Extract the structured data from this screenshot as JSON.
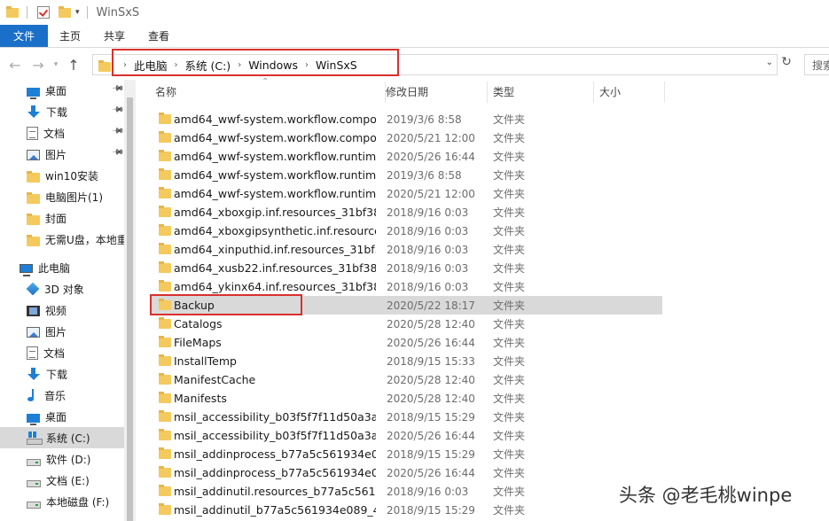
{
  "window": {
    "title": "WinSxS"
  },
  "ribbon": {
    "tabs": [
      "文件",
      "主页",
      "共享",
      "查看"
    ]
  },
  "address": {
    "crumbs": [
      "此电脑",
      "系统 (C:)",
      "Windows",
      "WinSxS"
    ],
    "search_placeholder": "搜索"
  },
  "sidebar": {
    "quick_access": [
      {
        "label": "桌面",
        "icon": "desktop-icon",
        "pinned": true
      },
      {
        "label": "下载",
        "icon": "download-icon",
        "pinned": true
      },
      {
        "label": "文档",
        "icon": "document-icon",
        "pinned": true
      },
      {
        "label": "图片",
        "icon": "picture-icon",
        "pinned": true
      },
      {
        "label": "win10安装",
        "icon": "folder-icon",
        "pinned": false
      },
      {
        "label": "电脑图片(1)",
        "icon": "folder-icon",
        "pinned": false
      },
      {
        "label": "封面",
        "icon": "folder-icon",
        "pinned": false
      },
      {
        "label": "无需U盘，本地重",
        "icon": "folder-icon",
        "pinned": false
      }
    ],
    "this_pc_label": "此电脑",
    "this_pc": [
      {
        "label": "3D 对象",
        "icon": "3d-objects-icon"
      },
      {
        "label": "视频",
        "icon": "video-icon"
      },
      {
        "label": "图片",
        "icon": "picture-icon"
      },
      {
        "label": "文档",
        "icon": "document-icon"
      },
      {
        "label": "下载",
        "icon": "download-icon"
      },
      {
        "label": "音乐",
        "icon": "music-icon"
      },
      {
        "label": "桌面",
        "icon": "desktop-icon"
      },
      {
        "label": "系统 (C:)",
        "icon": "windows-drive-icon",
        "selected": true
      },
      {
        "label": "软件 (D:)",
        "icon": "drive-icon"
      },
      {
        "label": "文档 (E:)",
        "icon": "drive-icon"
      },
      {
        "label": "本地磁盘 (F:)",
        "icon": "drive-icon"
      }
    ]
  },
  "columns": {
    "name": "名称",
    "date": "修改日期",
    "type": "类型",
    "size": "大小"
  },
  "files": [
    {
      "name": "amd64_wwf-system.workflow.compo...",
      "date": "2019/3/6 8:58",
      "type": "文件夹"
    },
    {
      "name": "amd64_wwf-system.workflow.compo...",
      "date": "2020/5/21 12:00",
      "type": "文件夹"
    },
    {
      "name": "amd64_wwf-system.workflow.runtime...",
      "date": "2020/5/26 16:44",
      "type": "文件夹"
    },
    {
      "name": "amd64_wwf-system.workflow.runtime...",
      "date": "2019/3/6 8:58",
      "type": "文件夹"
    },
    {
      "name": "amd64_wwf-system.workflow.runtime...",
      "date": "2020/5/21 12:00",
      "type": "文件夹"
    },
    {
      "name": "amd64_xboxgip.inf.resources_31bf38...",
      "date": "2018/9/16 0:03",
      "type": "文件夹"
    },
    {
      "name": "amd64_xboxgipsynthetic.inf.resource...",
      "date": "2018/9/16 0:03",
      "type": "文件夹"
    },
    {
      "name": "amd64_xinputhid.inf.resources_31bf3...",
      "date": "2018/9/16 0:03",
      "type": "文件夹"
    },
    {
      "name": "amd64_xusb22.inf.resources_31bf385...",
      "date": "2018/9/16 0:03",
      "type": "文件夹"
    },
    {
      "name": "amd64_ykinx64.inf.resources_31bf385...",
      "date": "2018/9/16 0:03",
      "type": "文件夹"
    },
    {
      "name": "Backup",
      "date": "2020/5/22 18:17",
      "type": "文件夹",
      "selected": true
    },
    {
      "name": "Catalogs",
      "date": "2020/5/28 12:40",
      "type": "文件夹"
    },
    {
      "name": "FileMaps",
      "date": "2020/5/26 16:44",
      "type": "文件夹"
    },
    {
      "name": "InstallTemp",
      "date": "2018/9/15 15:33",
      "type": "文件夹"
    },
    {
      "name": "ManifestCache",
      "date": "2020/5/28 12:40",
      "type": "文件夹"
    },
    {
      "name": "Manifests",
      "date": "2020/5/28 12:40",
      "type": "文件夹"
    },
    {
      "name": "msil_accessibility_b03f5f7f11d50a3a_...",
      "date": "2018/9/15 15:29",
      "type": "文件夹"
    },
    {
      "name": "msil_accessibility_b03f5f7f11d50a3a_...",
      "date": "2020/5/26 16:44",
      "type": "文件夹"
    },
    {
      "name": "msil_addinprocess_b77a5c561934e08...",
      "date": "2018/9/15 15:29",
      "type": "文件夹"
    },
    {
      "name": "msil_addinprocess_b77a5c561934e08...",
      "date": "2020/5/26 16:44",
      "type": "文件夹"
    },
    {
      "name": "msil_addinutil.resources_b77a5c5619...",
      "date": "2018/9/16 0:03",
      "type": "文件夹"
    },
    {
      "name": "msil_addinutil_b77a5c561934e089_4.0...",
      "date": "2018/9/15 15:29",
      "type": "文件夹"
    }
  ],
  "watermark": "头条 @老毛桃winpe"
}
